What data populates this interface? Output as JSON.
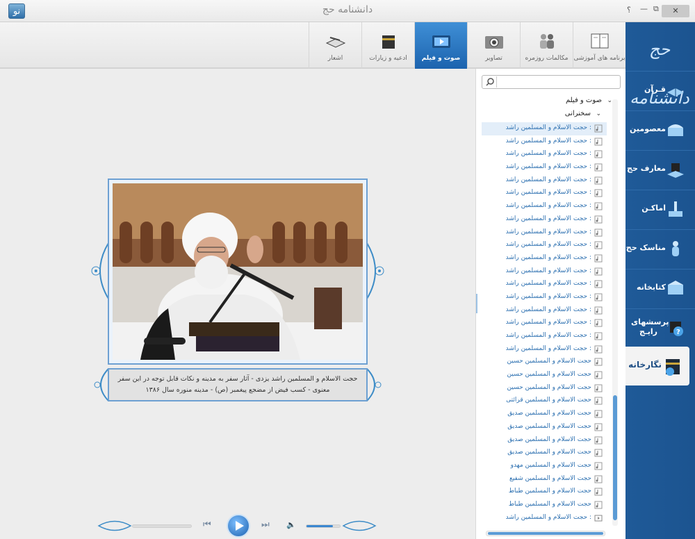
{
  "window": {
    "title": "دانشنامه حج",
    "app_icon": "نو",
    "help_label": "؟",
    "restore_label": "⧉",
    "minimize_label": "—",
    "close_label": "✕"
  },
  "sidebar": {
    "logo_text": "حج دانشنامه",
    "items": [
      {
        "label": "قـرآن",
        "icon": "quran-icon"
      },
      {
        "label": "معصومین",
        "icon": "shrine-icon"
      },
      {
        "label": "معارف حج",
        "icon": "kaaba-book-icon"
      },
      {
        "label": "اماکـن",
        "icon": "mosque-icon"
      },
      {
        "label": "مناسک حج",
        "icon": "pilgrim-icon"
      },
      {
        "label": "کتابخانه",
        "icon": "library-icon"
      },
      {
        "label": "پرسشهای رایـج",
        "icon": "question-kaaba-icon"
      },
      {
        "label": "نگارخانه",
        "icon": "gallery-icon",
        "active": true
      }
    ]
  },
  "tabs": [
    {
      "label": "برنامه های آموزشی",
      "icon": "book-icon"
    },
    {
      "label": "مکالمات روزمره",
      "icon": "people-icon"
    },
    {
      "label": "تصاویر",
      "icon": "camera-icon"
    },
    {
      "label": "صوت و فیلم",
      "icon": "film-icon",
      "active": true
    },
    {
      "label": "ادعیه و زیارات",
      "icon": "kaaba-icon"
    },
    {
      "label": "اشعار",
      "icon": "poem-book-icon"
    }
  ],
  "search": {
    "placeholder": "",
    "value": ""
  },
  "tree": {
    "root_label": "صوت و فیلم",
    "sub_label": "سخنرانی",
    "items": [
      "حجت الاسلام و المسلمین راشد :",
      "حجت الاسلام و المسلمین راشد :",
      "حجت الاسلام و المسلمین راشد :",
      "حجت الاسلام و المسلمین راشد :",
      "حجت الاسلام و المسلمین راشد :",
      "حجت الاسلام و المسلمین راشد :",
      "حجت الاسلام و المسلمین راشد :",
      "حجت الاسلام و المسلمین راشد :",
      "حجت الاسلام و المسلمین راشد :",
      "حجت الاسلام و المسلمین راشد :",
      "حجت الاسلام و المسلمین راشد :",
      "حجت الاسلام و المسلمین راشد :",
      "حجت الاسلام و المسلمین راشد :",
      "حجت الاسلام و المسلمین راشد :",
      "حجت الاسلام و المسلمین راشد :",
      "حجت الاسلام و المسلمین راشد :",
      "حجت الاسلام و المسلمین راشد :",
      "حجت الاسلام و المسلمین راشد :",
      "حجت الاسلام و المسلمین حسین",
      "حجت الاسلام و المسلمین حسین",
      "حجت الاسلام و المسلمین حسین",
      "حجت الاسلام و المسلمین قرائتی",
      "حجت الاسلام و المسلمین صدیق",
      "حجت الاسلام و المسلمین صدیق",
      "حجت الاسلام و المسلمین صدیق",
      "حجت الاسلام و المسلمین صدیق",
      "حجت الاسلام و المسلمین مهدو",
      "حجت الاسلام و المسلمین شفیع",
      "حجت الاسلام و المسلمین طباط",
      "حجت الاسلام و المسلمین طباط",
      "حجت الاسلام و المسلمین راشد :"
    ]
  },
  "media": {
    "caption": "حجت الاسلام و المسلمین راشد یزدی - آثار سفر به مدینه و نکات قابل توجه در این سفر معنوی - کسب فیض از مضجع پیغمبر (ص) - مدینه منوره سال ۱۳۸۶"
  },
  "player": {
    "volume": 0.8,
    "progress": 0
  },
  "colors": {
    "sidebar": "#1f5a98",
    "accent": "#2b6fb0",
    "active_tab": "#2a78c4"
  }
}
